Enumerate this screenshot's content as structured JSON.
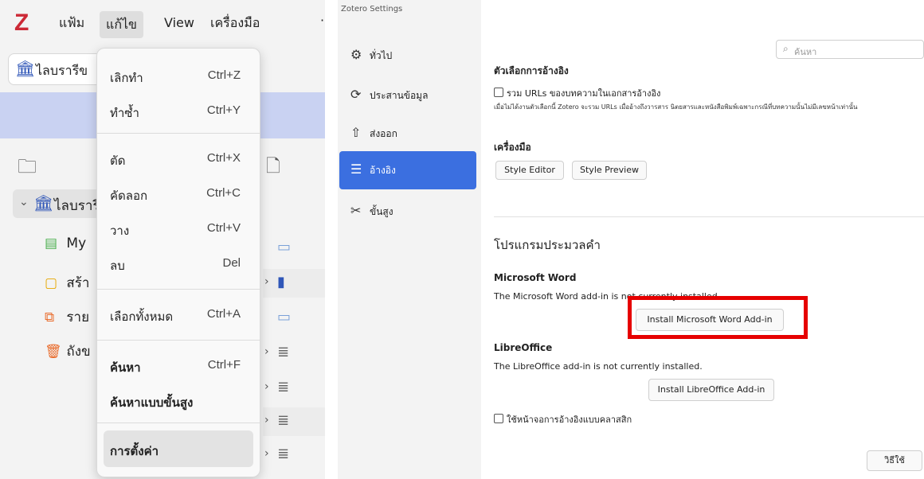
{
  "main_window": {
    "menubar": {
      "logo": "Z",
      "file": "แฟ้ม",
      "edit": "แก้ไข",
      "view": "View",
      "tools": "เครื่องมือ"
    },
    "library_tab": "ไลบรารีข",
    "collection_tree": {
      "library": "ไลบรารี",
      "my": "My",
      "create": "สร้า",
      "report": "ราย",
      "trash": "ถังข"
    },
    "edit_menu": [
      {
        "label": "เลิกทำ",
        "shortcut": "Ctrl+Z"
      },
      {
        "label": "ทำซ้ำ",
        "shortcut": "Ctrl+Y"
      },
      {
        "label": "ตัด",
        "shortcut": "Ctrl+X"
      },
      {
        "label": "คัดลอก",
        "shortcut": "Ctrl+C"
      },
      {
        "label": "วาง",
        "shortcut": "Ctrl+V"
      },
      {
        "label": "ลบ",
        "shortcut": "Del"
      },
      {
        "label": "เลือกทั้งหมด",
        "shortcut": "Ctrl+A"
      },
      {
        "label": "ค้นหา",
        "shortcut": "Ctrl+F"
      },
      {
        "label": "ค้นหาแบบขั้นสูง",
        "shortcut": ""
      },
      {
        "label": "การตั้งค่า",
        "shortcut": ""
      }
    ]
  },
  "settings_window": {
    "title": "Zotero Settings",
    "nav": [
      {
        "label": "ทั่วไป",
        "icon": "gear-icon"
      },
      {
        "label": "ประสานข้อมูล",
        "icon": "sync-icon"
      },
      {
        "label": "ส่งออก",
        "icon": "export-icon"
      },
      {
        "label": "อ้างอิง",
        "icon": "cite-icon"
      },
      {
        "label": "ขั้นสูง",
        "icon": "advanced-icon"
      }
    ],
    "search_placeholder": "ค้นหา",
    "citation_options_title": "ตัวเลือกการอ้างอิง",
    "include_urls_label": "รวม URLs ของบทความในเอกสารอ้างอิง",
    "include_urls_desc": "เมื่อไม่ได้งานตัวเลือกนี้ Zotero จะรวม URLs เมื่ออ้างถึงวารสาร นิตยสารและหนังสือพิมพ์เฉพาะกรณีที่บทความนั้นไม่มีเลขหน้าเท่านั้น",
    "tools_title": "เครื่องมือ",
    "style_editor": "Style Editor",
    "style_preview": "Style Preview",
    "word_processors_title": "โปรแกรมประมวลคำ",
    "word_title": "Microsoft Word",
    "word_status": "The Microsoft Word add-in is not currently installed.",
    "install_word": "Install Microsoft Word Add-in",
    "libre_title": "LibreOffice",
    "libre_status": "The LibreOffice add-in is not currently installed.",
    "install_libre": "Install LibreOffice Add-in",
    "classic_cite_label": "ใช้หน้าจอการอ้างอิงแบบคลาสสิก",
    "help_button": "วิธีใช้"
  },
  "colors": {
    "accent": "#3b6fe0",
    "highlight_box": "#e60000",
    "library_band": "#c9d2f2",
    "logo": "#cc2936"
  }
}
